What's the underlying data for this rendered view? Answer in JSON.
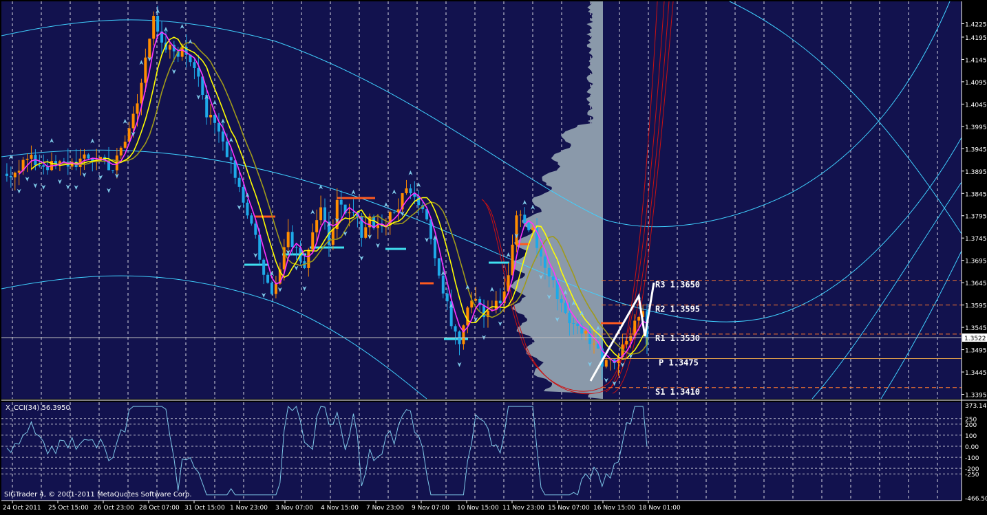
{
  "colors": {
    "background": "#12124e",
    "frame": "#000000",
    "grid": "#ffffff",
    "text": "#ffffff",
    "bull": "#ff8c00",
    "bear": "#1ea9e8",
    "arrow": "#7ec8e8",
    "ma_fast": "#ff33ff",
    "ma_mid": "#ffff00",
    "ma_slow": "#a09a1a",
    "envelope": "#40d0ff",
    "profile": "#8a99aa",
    "parabola": "#cc1111",
    "pivot_line": "#ff7a2e",
    "pivot_p": "#e8a44a",
    "bid_line": "#c0c0c0",
    "cci": "#7ec8e8",
    "zigzag": "#ffffff",
    "stop_orange": "#ff5a1f",
    "stop_cyan": "#40e0f0"
  },
  "chart_data": [
    {
      "type": "candlestick",
      "title": "",
      "price_axis": {
        "range": [
          1.3385,
          1.4275
        ],
        "ticks": [
          "1.4225",
          "1.4195",
          "1.4145",
          "1.4095",
          "1.4045",
          "1.3995",
          "1.3945",
          "1.3895",
          "1.3845",
          "1.3795",
          "1.3745",
          "1.3695",
          "1.3645",
          "1.3595",
          "1.3545",
          "1.3495",
          "1.3445",
          "1.3395"
        ],
        "current_price": "1.3522"
      },
      "time_axis": {
        "labels": [
          "24 Oct 2011",
          "25 Oct 15:00",
          "26 Oct 23:00",
          "28 Oct 07:00",
          "31 Oct 15:00",
          "1 Nov 23:00",
          "3 Nov 07:00",
          "4 Nov 15:00",
          "7 Nov 23:00",
          "9 Nov 07:00",
          "10 Nov 15:00",
          "11 Nov 23:00",
          "15 Nov 07:00",
          "16 Nov 15:00",
          "18 Nov 01:00"
        ]
      },
      "price_path": [
        [
          0,
          1.388
        ],
        [
          6,
          1.392
        ],
        [
          12,
          1.3905
        ],
        [
          18,
          1.3915
        ],
        [
          24,
          1.3925
        ],
        [
          27,
          1.39
        ],
        [
          30,
          1.396
        ],
        [
          33,
          1.405
        ],
        [
          35,
          1.416
        ],
        [
          37,
          1.423
        ],
        [
          39,
          1.417
        ],
        [
          42,
          1.4165
        ],
        [
          45,
          1.416
        ],
        [
          48,
          1.412
        ],
        [
          50,
          1.402
        ],
        [
          53,
          1.398
        ],
        [
          56,
          1.392
        ],
        [
          59,
          1.383
        ],
        [
          62,
          1.375
        ],
        [
          64,
          1.366
        ],
        [
          66,
          1.362
        ],
        [
          68,
          1.369
        ],
        [
          70,
          1.376
        ],
        [
          72,
          1.372
        ],
        [
          74,
          1.369
        ],
        [
          76,
          1.376
        ],
        [
          78,
          1.38
        ],
        [
          80,
          1.374
        ],
        [
          82,
          1.382
        ],
        [
          84,
          1.379
        ],
        [
          86,
          1.38
        ],
        [
          88,
          1.376
        ],
        [
          90,
          1.379
        ],
        [
          92,
          1.377
        ],
        [
          94,
          1.378
        ],
        [
          96,
          1.38
        ],
        [
          98,
          1.384
        ],
        [
          100,
          1.386
        ],
        [
          102,
          1.383
        ],
        [
          104,
          1.38
        ],
        [
          106,
          1.37
        ],
        [
          108,
          1.362
        ],
        [
          110,
          1.356
        ],
        [
          112,
          1.352
        ],
        [
          114,
          1.36
        ],
        [
          116,
          1.362
        ],
        [
          118,
          1.358
        ],
        [
          120,
          1.359
        ],
        [
          122,
          1.36
        ],
        [
          124,
          1.365
        ],
        [
          126,
          1.38
        ],
        [
          128,
          1.378
        ],
        [
          130,
          1.376
        ],
        [
          132,
          1.37
        ],
        [
          134,
          1.366
        ],
        [
          136,
          1.362
        ],
        [
          138,
          1.358
        ],
        [
          140,
          1.3545
        ],
        [
          142,
          1.354
        ],
        [
          145,
          1.351
        ],
        [
          147,
          1.347
        ],
        [
          149,
          1.348
        ],
        [
          151,
          1.348
        ],
        [
          153,
          1.352
        ],
        [
          155,
          1.356
        ],
        [
          157,
          1.358
        ],
        [
          158,
          1.352
        ]
      ],
      "support_resistance": [
        {
          "label": "R3",
          "value": "1.3650",
          "text": "R3  1.3650"
        },
        {
          "label": "R2",
          "value": "1.3595",
          "text": "R2  1.3595"
        },
        {
          "label": "R1",
          "value": "1.3530",
          "text": "R1  1.3530"
        },
        {
          "label": "P",
          "value": "1.3475",
          "text": "P  1.3475"
        },
        {
          "label": "S1",
          "value": "1.3410",
          "text": "S1  1.3410"
        }
      ],
      "zigzag": [
        [
          1.3425,
          "16 Nov 15:00"
        ],
        [
          1.3615,
          "18 Nov 01:00"
        ],
        [
          1.3525,
          "18 Nov 01:00"
        ],
        [
          1.3645,
          "18 Nov 01:00"
        ]
      ]
    },
    {
      "type": "line",
      "title": "X_CCI(34) 56.3950",
      "indicator_label": "X_CCI(34) 56.3950",
      "axis_ticks": [
        "373.148",
        "250",
        "200",
        "100",
        "0.00",
        "-100",
        "-200",
        "-250",
        "-466.501"
      ],
      "levels": [
        250,
        200,
        100,
        0,
        -100,
        -200,
        -250
      ],
      "range": [
        -466.501,
        373.148
      ]
    }
  ],
  "footer": {
    "copyright": "SIGTrader 4, © 2001-2011 MetaQuotes Software Corp."
  }
}
